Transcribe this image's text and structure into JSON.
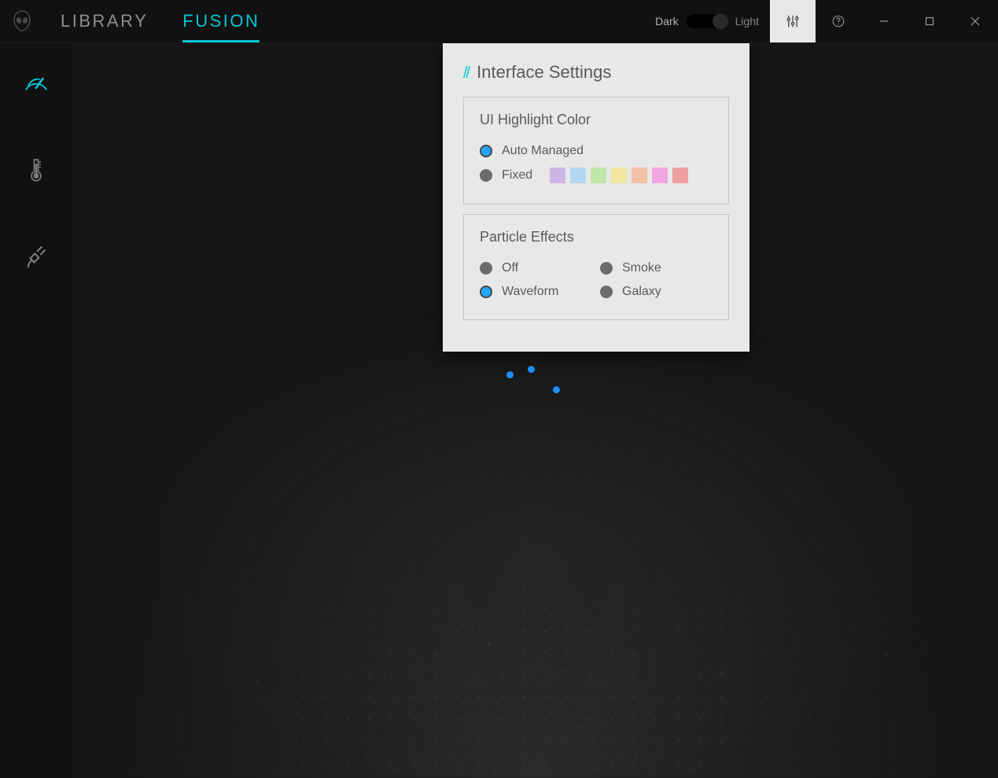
{
  "accent": "#00c8d6",
  "nav": {
    "tabs": [
      "LIBRARY",
      "FUSION"
    ],
    "activeTab": 1
  },
  "theme": {
    "darkLabel": "Dark",
    "lightLabel": "Light",
    "current": "dark"
  },
  "sidebar": {
    "items": [
      "performance",
      "thermal",
      "power"
    ],
    "active": 0
  },
  "settingsPanel": {
    "title": "Interface Settings",
    "highlight": {
      "heading": "UI Highlight Color",
      "autoLabel": "Auto Managed",
      "fixedLabel": "Fixed",
      "selected": "auto",
      "swatches": [
        "#cdb4e6",
        "#b5d6f0",
        "#bfe7a8",
        "#f2e6a0",
        "#f2bfa3",
        "#f0a6e0",
        "#f0a0a0"
      ]
    },
    "particle": {
      "heading": "Particle Effects",
      "options": [
        {
          "key": "off",
          "label": "Off"
        },
        {
          "key": "smoke",
          "label": "Smoke"
        },
        {
          "key": "waveform",
          "label": "Waveform"
        },
        {
          "key": "galaxy",
          "label": "Galaxy"
        }
      ],
      "selected": "waveform"
    }
  }
}
